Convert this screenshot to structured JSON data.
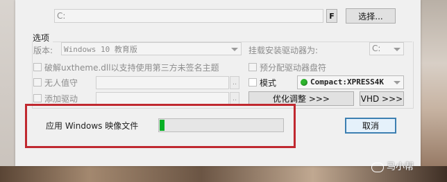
{
  "source": {
    "path_value": "C:",
    "f_button": "F",
    "browse_button": "选择..."
  },
  "options": {
    "title": "选项",
    "version_label": "版本:",
    "version_value": "Windows 10 教育版",
    "mount_label": "挂载安装驱动器为:",
    "mount_value": "C:",
    "uxtheme_label": "破解uxtheme.dll以支持使用第三方未签名主题",
    "prealloc_label": "预分配驱动器盘符",
    "unattend_label": "无人值守",
    "unattend_browse": "..",
    "mode_label": "模式",
    "mode_value": "Compact:XPRESS4K",
    "add_driver_label": "添加驱动",
    "add_driver_browse": "..",
    "tweak_button": "优化调整 >>>",
    "vhd_button": "VHD >>>"
  },
  "status": {
    "text": "应用 Windows 映像文件",
    "progress": 0.04,
    "cancel_button": "取消"
  },
  "colors": {
    "progress_green": "#06b025",
    "highlight_red": "#c0282f",
    "mode_indicator": "#2db52d"
  },
  "watermark": {
    "text": "马小帮"
  }
}
